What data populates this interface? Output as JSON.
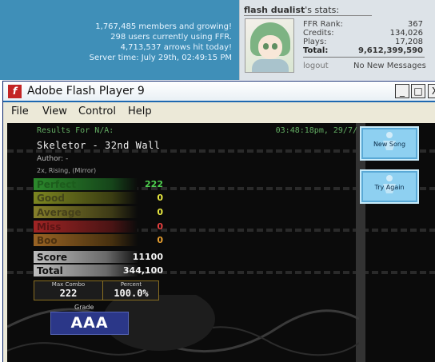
{
  "site": {
    "stats": [
      "1,767,485 members and growing!",
      "298 users currently using FFR.",
      "4,713,537 arrows hit today!",
      "Server time: July 29th, 02:49:15 PM"
    ]
  },
  "user": {
    "name": "flash dualist",
    "title_suffix": "'s stats:",
    "stats": [
      {
        "label": "FFR Rank:",
        "value": "367"
      },
      {
        "label": "Credits:",
        "value": "134,026"
      },
      {
        "label": "Plays:",
        "value": "17,208"
      },
      {
        "label": "Total:",
        "value": "9,612,399,590"
      }
    ],
    "logout": "logout",
    "messages": "No New Messages"
  },
  "window": {
    "title": "Adobe Flash Player 9",
    "minimize": "_",
    "maximize": "□",
    "close": "X",
    "menu": [
      "File",
      "View",
      "Control",
      "Help"
    ]
  },
  "game": {
    "results_for": "Results For N/A:",
    "timestamp": "03:48:18pm, 29/7/",
    "song": "Skeletor - 32nd Wall",
    "author": "Author: -",
    "mods": "2x, Rising, (Mirror)",
    "judgements": [
      {
        "label": "Perfect",
        "value": "222",
        "color": "#4fd04f"
      },
      {
        "label": "Good",
        "value": "0",
        "color": "#e8e840"
      },
      {
        "label": "Average",
        "value": "0",
        "color": "#e8e840"
      },
      {
        "label": "Miss",
        "value": "0",
        "color": "#e84040"
      },
      {
        "label": "Boo",
        "value": "0",
        "color": "#e8a030"
      }
    ],
    "judgement_colors": {
      "Perfect": "#1f6e1f",
      "Good": "#5e6418",
      "Average": "#5e5a18",
      "Miss": "#6e1818",
      "Boo": "#6e4418"
    },
    "score_label": "Score",
    "score": "11100",
    "total_label": "Total",
    "total": "344,100",
    "max_combo_label": "Max Combo",
    "max_combo": "222",
    "percent_label": "Percent",
    "percent": "100.0%",
    "grade_label": "Grade",
    "grade": "AAA",
    "buttons": {
      "new_song": "New Song",
      "try_again": "Try Again"
    }
  }
}
